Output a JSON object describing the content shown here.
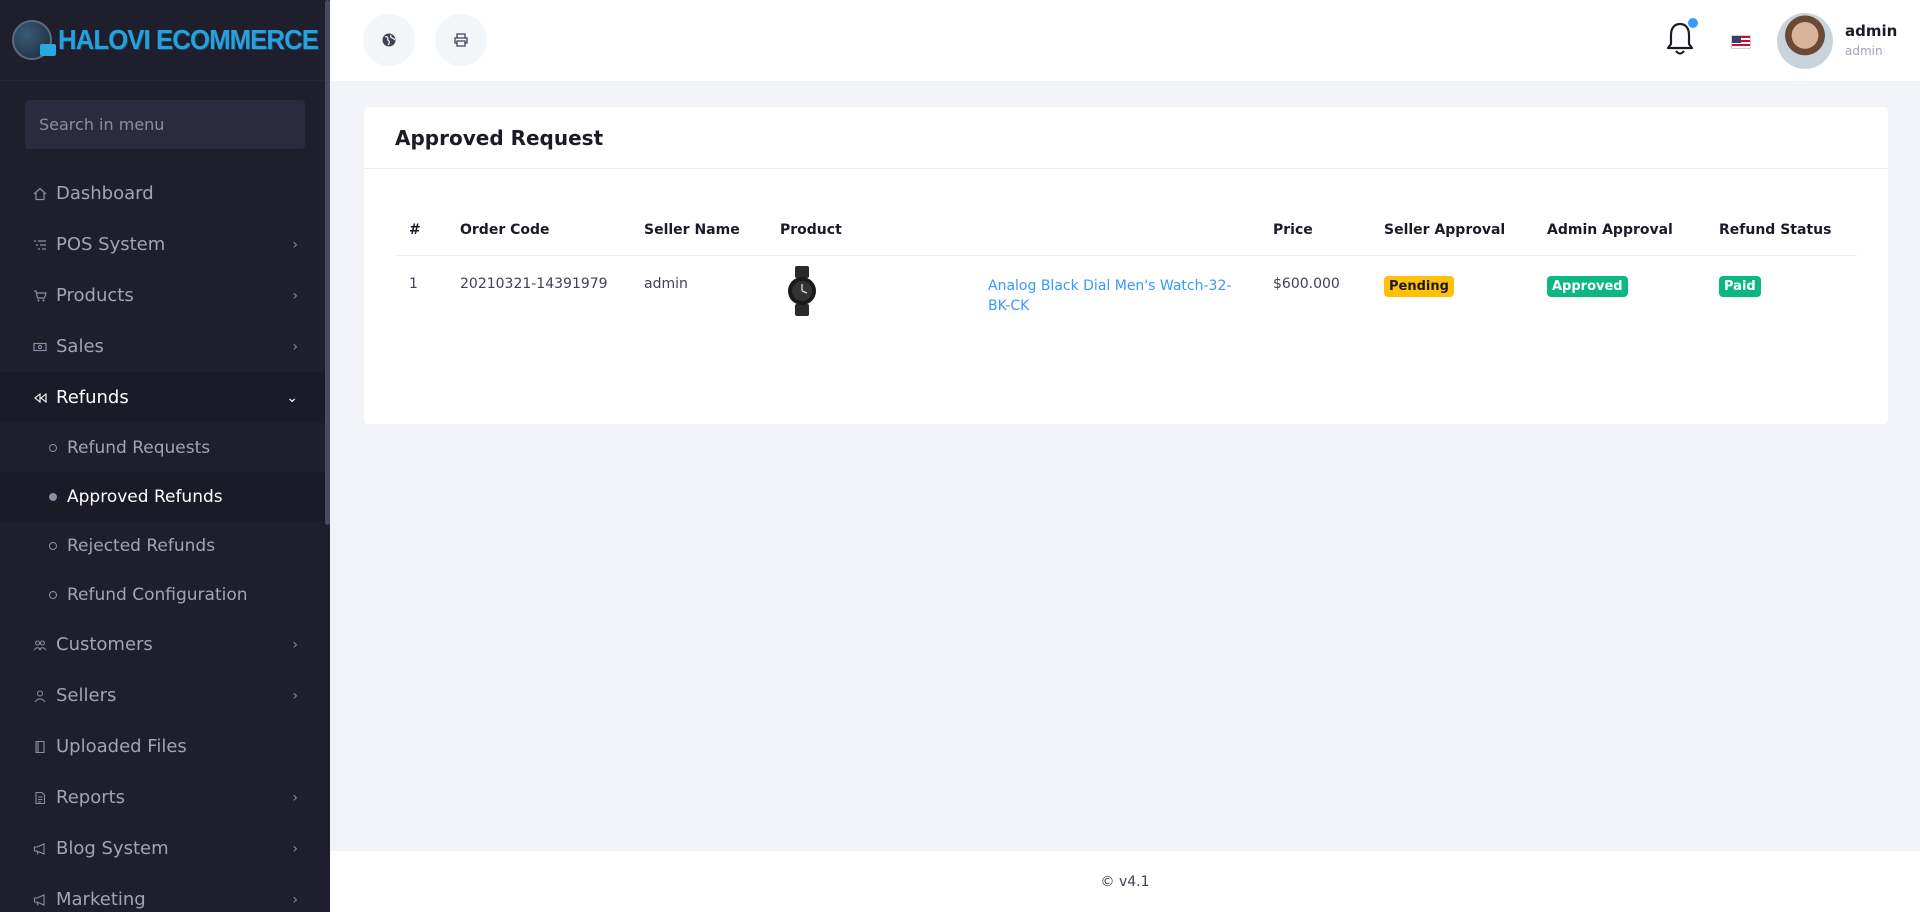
{
  "brand": {
    "name": "HALOVI ECOMMERCE CMS"
  },
  "sidebar": {
    "search_placeholder": "Search in menu",
    "items": [
      {
        "label": "Dashboard",
        "icon": "home-icon",
        "chevron": false
      },
      {
        "label": "POS System",
        "icon": "list-icon",
        "chevron": true
      },
      {
        "label": "Products",
        "icon": "cart-icon",
        "chevron": true
      },
      {
        "label": "Sales",
        "icon": "money-icon",
        "chevron": true
      },
      {
        "label": "Refunds",
        "icon": "backward-icon",
        "chevron": true,
        "open": true
      },
      {
        "label": "Customers",
        "icon": "users-icon",
        "chevron": true
      },
      {
        "label": "Sellers",
        "icon": "user-icon",
        "chevron": true
      },
      {
        "label": "Uploaded Files",
        "icon": "folder-icon",
        "chevron": false
      },
      {
        "label": "Reports",
        "icon": "file-icon",
        "chevron": true
      },
      {
        "label": "Blog System",
        "icon": "megaphone-icon",
        "chevron": true
      },
      {
        "label": "Marketing",
        "icon": "bullhorn-icon",
        "chevron": true
      }
    ],
    "refund_sub": [
      {
        "label": "Refund Requests",
        "active": false
      },
      {
        "label": "Approved Refunds",
        "active": true
      },
      {
        "label": "Rejected Refunds",
        "active": false
      },
      {
        "label": "Refund Configuration",
        "active": false
      }
    ]
  },
  "topbar": {
    "left_buttons": [
      "globe-icon",
      "printer-icon"
    ],
    "user": {
      "name": "admin",
      "role": "admin"
    }
  },
  "card": {
    "title": "Approved Request",
    "columns": [
      "#",
      "Order Code",
      "Seller Name",
      "Product",
      "",
      "Price",
      "Seller Approval",
      "Admin Approval",
      "Refund Status"
    ],
    "rows": [
      {
        "index": "1",
        "order_code": "20210321-14391979",
        "seller": "admin",
        "product_name": "Analog Black Dial Men's Watch-32-BK-CK",
        "price": "$600.000",
        "seller_approval": "Pending",
        "admin_approval": "Approved",
        "refund_status": "Paid"
      }
    ]
  },
  "footer": {
    "version": "© v4.1"
  },
  "colors": {
    "sidebar_bg": "#1e1e2d",
    "link": "#3699ff",
    "warning": "#ffc107",
    "success": "#0bb783"
  }
}
